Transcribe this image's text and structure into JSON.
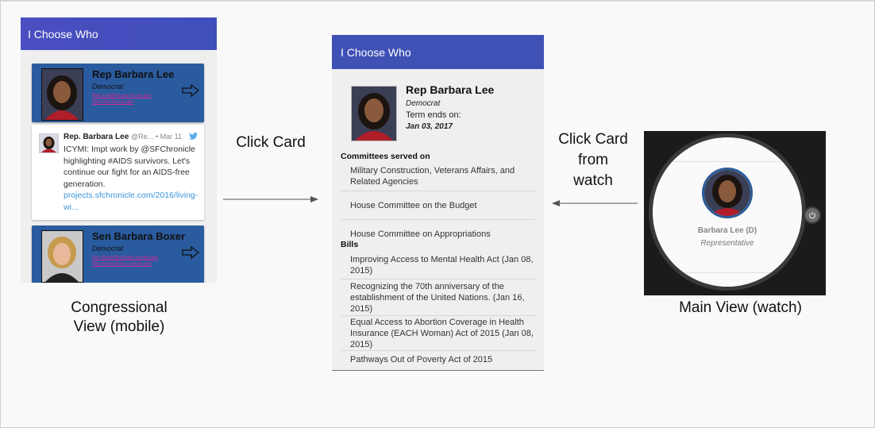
{
  "app_title": "I Choose Who",
  "mobile": {
    "caption_line1": "Congressional",
    "caption_line2": "View (mobile)",
    "cards": [
      {
        "name": "Rep Barbara Lee",
        "party": "Democrat",
        "link1": "Rep.Lee@house.house.gov",
        "link2": "http://lee.house.gov"
      },
      {
        "name": "Sen Barbara Boxer",
        "party": "Democrat",
        "link1": "Sen.Boxer@senate.senate.gov",
        "link2": "http://www.boxer.senate.gov"
      }
    ],
    "tweet": {
      "author": "Rep. Barbara Lee",
      "handle": "@Re...",
      "date": "• Mar 11",
      "text": "ICYMI: Impt work by @SFChronicle highlighting #AIDS survivors. Let's continue our fight for an AIDS-free generation.",
      "url": "projects.sfchronicle.com/2016/living-wi..."
    }
  },
  "flow": {
    "click_card": "Click Card",
    "click_card_watch_line1": "Click Card",
    "click_card_watch_line2": "from",
    "click_card_watch_line3": "watch"
  },
  "detail": {
    "name": "Rep Barbara Lee",
    "party": "Democrat",
    "term_label": "Term ends on:",
    "term_date": "Jan 03, 2017",
    "committees_heading": "Committees served on",
    "committees": [
      "Military Construction, Veterans Affairs, and Related Agencies",
      "House Committee on the Budget",
      "House Committee on Appropriations"
    ],
    "bills_heading": "Bills",
    "bills": [
      "Improving Access to Mental Health Act (Jan 08, 2015)",
      "Recognizing the 70th anniversary of the establishment of the United Nations. (Jan 16, 2015)",
      "Equal Access to Abortion Coverage in Health Insurance (EACH Woman) Act of 2015 (Jan 08, 2015)",
      "Pathways Out of Poverty Act of 2015"
    ]
  },
  "watch": {
    "name": "Barbara Lee (D)",
    "role": "Representative",
    "caption": "Main View (watch)"
  },
  "colors": {
    "app_bar": "#3f51b5",
    "card_blue": "#2a5b9e",
    "link_magenta": "#d3289a",
    "tweet_link": "#3b94d9"
  }
}
